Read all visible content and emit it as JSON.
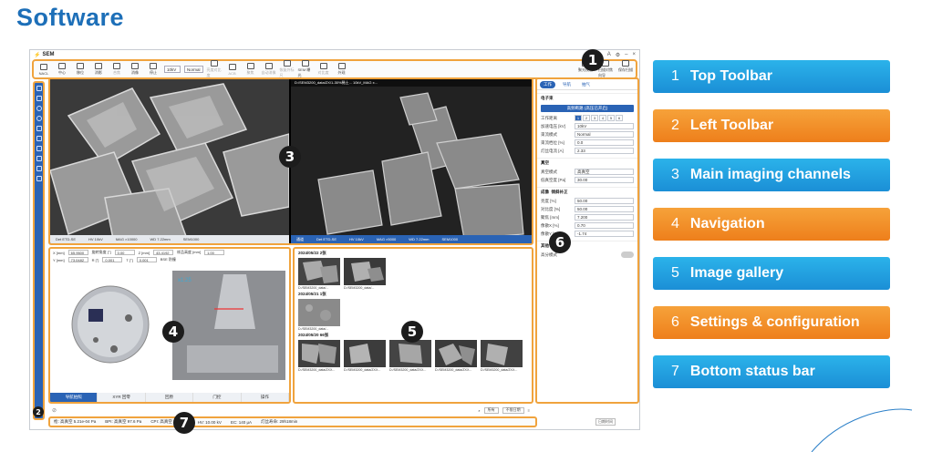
{
  "slide": {
    "title": "Software"
  },
  "app": {
    "name": "SEM",
    "window_controls": [
      "A",
      "⚙",
      "–",
      "×"
    ],
    "toolbar": {
      "buttons": [
        "NACL",
        "中心",
        "移位",
        "消影",
        "合焦",
        "消像",
        "停止"
      ],
      "voltage": "10kV",
      "mode": "Normal",
      "tools": [
        "亮度对比度",
        "ACB",
        "聚焦",
        "自动消像",
        "恢复外标尺",
        "SEM 曝光",
        "对比度",
        "外观"
      ],
      "right_items": [
        "聚光校准",
        "扫描对焦向导",
        "保存扫描"
      ]
    },
    "imaging": {
      "channel1_bar": [
        "Det ETD-SE",
        "HV 10kV",
        "MAG ×10000",
        "WD 7.22mm",
        "SEM1000"
      ],
      "channel2_top": "D:/SEM3200_data/ZX/1-30%稀土... 10kV_MAG x...",
      "channel2_bar": [
        "Det ETD-SE",
        "HV 10kV",
        "MAG ×5000",
        "WD 7.22mm",
        "SEM1000"
      ],
      "channel2_tab": "通道"
    },
    "navigation": {
      "fields_row1": [
        {
          "label": "X [mm]",
          "value": "65.9600"
        },
        {
          "label": "旋转角度 [°]",
          "value": "0.00"
        },
        {
          "label": "Z [mm]",
          "value": "43.4192"
        },
        {
          "label": "样品高度 [mm]",
          "value": "1.00"
        }
      ],
      "fields_row2": [
        {
          "label": "Y [mm]",
          "value": "73.0482"
        },
        {
          "label": "R [°]",
          "value": "0.001"
        },
        {
          "label": "T [°]",
          "value": "0.001"
        },
        {
          "label": "",
          "value": "BSE 防撞"
        }
      ],
      "zoom": "x1.25",
      "tabs": [
        "导航拍照",
        "XYR 回零",
        "回原",
        "门控",
        "操作"
      ]
    },
    "gallery": {
      "groups": [
        {
          "date": "2024/05/22 2张",
          "items": [
            "D:/SEM3200_data/...",
            "D:/SEM3200_data/..."
          ]
        },
        {
          "date": "2024/05/21 1张",
          "items": [
            "D:/SEM3200_data/..."
          ]
        },
        {
          "date": "2024/05/20 66张",
          "items": [
            "D:/SEM3200_data/ZXX...",
            "D:/SEM3200_data/ZXX...",
            "D:/SEM3200_data/ZXX...",
            "D:/SEM3200_data/ZXX...",
            "D:/SEM3200_data/ZXX..."
          ]
        }
      ],
      "filters": [
        "所有",
        "不限日期"
      ]
    },
    "settings": {
      "tabs": [
        "工作",
        "导航",
        "抽气"
      ],
      "section_beam": "电子束",
      "beam_button": "高频断路 (高压已开启)",
      "work_dist_label": "工作距离",
      "steps": [
        "1",
        "2",
        "3",
        "4",
        "5",
        "6"
      ],
      "rows": [
        {
          "label": "加速电压 [kV]",
          "value": "10kV"
        },
        {
          "label": "束流模式",
          "value": "Normal"
        },
        {
          "label": "束流档位 [%]",
          "value": "0.0"
        },
        {
          "label": "灯丝电流 [A]",
          "value": "2.33"
        }
      ],
      "section_vac": "真空",
      "vac_rows": [
        {
          "label": "真空模式",
          "value": "高真空"
        },
        {
          "label": "低真空度 [Pa]",
          "value": "30.00"
        }
      ],
      "section_scan": "成像",
      "scan_tab2": "倾斜补正",
      "scan_rows": [
        {
          "label": "亮度 [%]",
          "value": "50.00"
        },
        {
          "label": "对比度 [%]",
          "value": "50.00"
        },
        {
          "label": "聚焦 [mm]",
          "value": "7.200"
        },
        {
          "label": "像散X [%]",
          "value": "0.70"
        },
        {
          "label": "像散Y [%]",
          "value": "-1.74"
        }
      ],
      "section_other": "其他",
      "other_toggle": "高分模式",
      "bottom_button": "日期时间"
    },
    "status": [
      "枪: 高真空 5.21e-04 Pa",
      "BPI: 高真空 97.6 Pa",
      "CPI: 高真空 9.00e-...",
      "HV: 10.00 kV",
      "EC: 140 μA",
      "灯丝寿命: 29h18min"
    ]
  },
  "badges": [
    "1",
    "2",
    "3",
    "4",
    "5",
    "6",
    "7"
  ],
  "legend": [
    {
      "num": "1",
      "label": "Top Toolbar",
      "color": "blue"
    },
    {
      "num": "2",
      "label": "Left Toolbar",
      "color": "orange"
    },
    {
      "num": "3",
      "label": "Main imaging channels",
      "color": "blue"
    },
    {
      "num": "4",
      "label": "Navigation",
      "color": "orange"
    },
    {
      "num": "5",
      "label": "Image gallery",
      "color": "blue"
    },
    {
      "num": "6",
      "label": "Settings & configuration",
      "color": "orange"
    },
    {
      "num": "7",
      "label": "Bottom status bar",
      "color": "blue"
    }
  ],
  "colors": {
    "title": "#1d6fb8",
    "highlight": "#f0a33d",
    "blue": "#1b8fd6",
    "orange": "#ee7f1b",
    "app_blue": "#2a63b5"
  }
}
